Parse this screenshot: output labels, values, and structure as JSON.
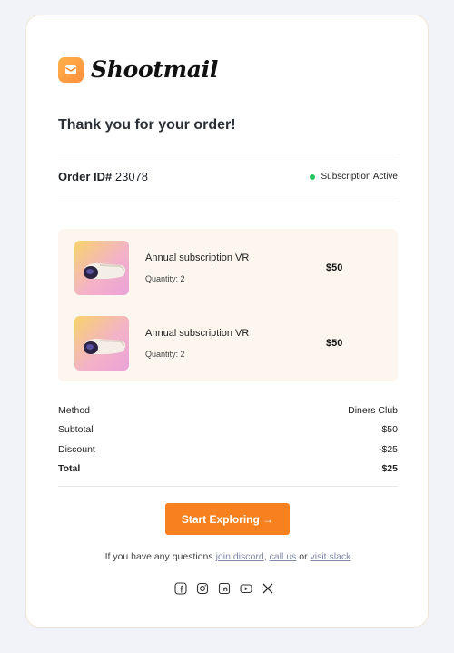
{
  "brand": {
    "name": "Shootmail",
    "accent": "#f7811f"
  },
  "heading": "Thank you for your order!",
  "order": {
    "id_label": "Order ID#",
    "id_value": "23078",
    "status": "Subscription Active",
    "status_color": "#22c55e"
  },
  "items": [
    {
      "name": "Annual subscription VR",
      "quantity": "Quantity: 2",
      "price": "$50"
    },
    {
      "name": "Annual subscription VR",
      "quantity": "Quantity: 2",
      "price": "$50"
    }
  ],
  "summary": [
    {
      "label": "Method",
      "value": "Diners Club"
    },
    {
      "label": "Subtotal",
      "value": "$50"
    },
    {
      "label": "Discount",
      "value": "-$25"
    },
    {
      "label": "Total",
      "value": "$25"
    }
  ],
  "cta": {
    "label": "Start Exploring →"
  },
  "help": {
    "prefix": "If you have any questions",
    "link1": "join discord",
    "sep1": ",",
    "link2": "call us",
    "sep2": "or",
    "link3": "visit slack"
  },
  "socials": [
    "facebook-icon",
    "instagram-icon",
    "linkedin-icon",
    "youtube-icon",
    "x-icon"
  ]
}
